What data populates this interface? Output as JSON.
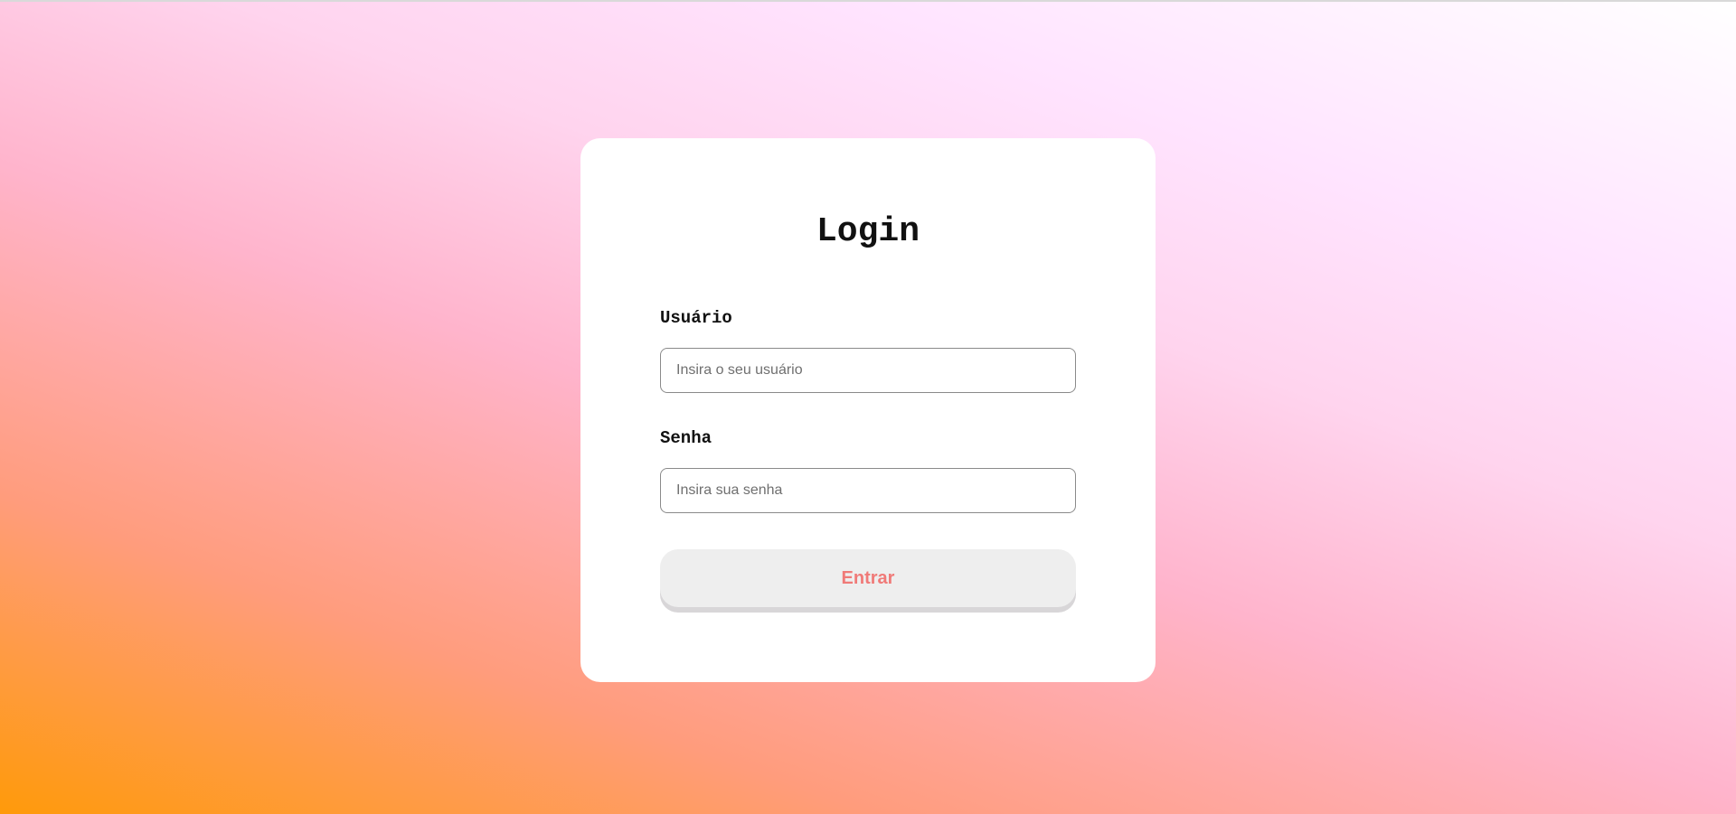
{
  "login": {
    "title": "Login",
    "username": {
      "label": "Usuário",
      "placeholder": "Insira o seu usuário",
      "value": ""
    },
    "password": {
      "label": "Senha",
      "placeholder": "Insira sua senha",
      "value": ""
    },
    "submit_label": "Entrar"
  },
  "colors": {
    "card_background": "#ffffff",
    "button_background": "#eeeeee",
    "button_text": "#f07a78",
    "gradient_start": "#ff9a0a",
    "gradient_end": "#ffffff"
  }
}
